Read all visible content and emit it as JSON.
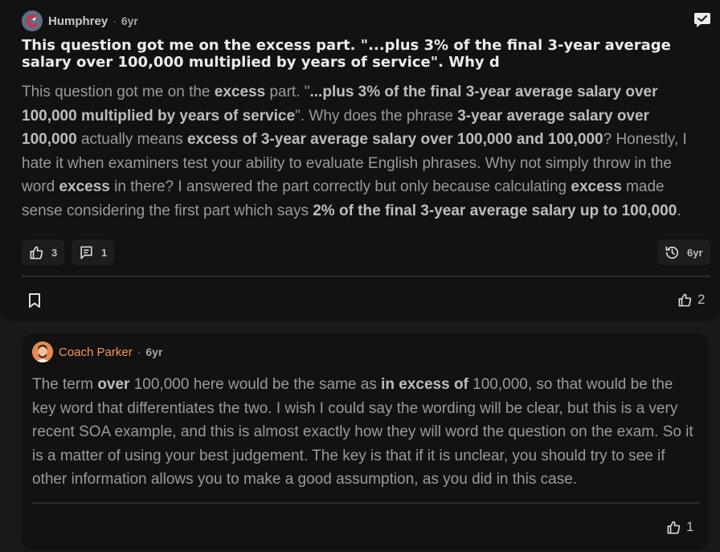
{
  "post": {
    "author": "Humphrey",
    "separator": "·",
    "age": "6yr",
    "title": "This question got me on the excess part. \"...plus 3% of the final 3-year average salary over 100,000 multiplied by years of service\". Why d",
    "body_segments": [
      {
        "text": "This question got me on the ",
        "bold": false
      },
      {
        "text": "excess",
        "bold": true
      },
      {
        "text": " part. \"",
        "bold": false
      },
      {
        "text": "...plus 3% of the final 3-year average salary over 100,000 multiplied by years of service",
        "bold": true
      },
      {
        "text": "\". Why does the phrase ",
        "bold": false
      },
      {
        "text": "3-year average salary over 100,000",
        "bold": true
      },
      {
        "text": " actually means ",
        "bold": false
      },
      {
        "text": "excess of 3-year average salary over 100,000 and 100,000",
        "bold": true
      },
      {
        "text": "? Honestly, I hate it when examiners test your ability to evaluate English phrases. Why not simply throw in the word ",
        "bold": false
      },
      {
        "text": "excess",
        "bold": true
      },
      {
        "text": " in there? I answered the part correctly but only because calculating ",
        "bold": false
      },
      {
        "text": "excess",
        "bold": true
      },
      {
        "text": " made sense considering the first part which says ",
        "bold": false
      },
      {
        "text": "2% of the final 3-year average salary up to 100,000",
        "bold": true
      },
      {
        "text": ".",
        "bold": false
      }
    ],
    "likes": "3",
    "comments": "1",
    "history_age": "6yr",
    "bottom_likes": "2"
  },
  "reply": {
    "author": "Coach Parker",
    "separator": "·",
    "age": "6yr",
    "body_segments": [
      {
        "text": "The term ",
        "bold": false
      },
      {
        "text": "over",
        "bold": true
      },
      {
        "text": " 100,000 here would be the same as ",
        "bold": false
      },
      {
        "text": "in excess of",
        "bold": true
      },
      {
        "text": " 100,000, so that would be the key word that differentiates the two. I wish I could say the wording will be clear, but this is a very recent SOA example, and this is almost exactly how they will word the question on the exam. So it is a matter of using your best judgement. The key is that if it is unclear, you should try to see if other information allows you to make a good assumption, as you did in this case.",
        "bold": false
      }
    ],
    "likes": "1"
  },
  "colors": {
    "background": "#191919",
    "card": "#121212",
    "coach_name": "#f5955b",
    "brand_red": "#e0283a"
  },
  "icons": {
    "author_avatar": "magnet-logo-icon",
    "message": "message-check-icon",
    "like": "thumbs-up-icon",
    "comment": "comment-icon",
    "history": "history-icon",
    "bookmark": "bookmark-icon"
  }
}
